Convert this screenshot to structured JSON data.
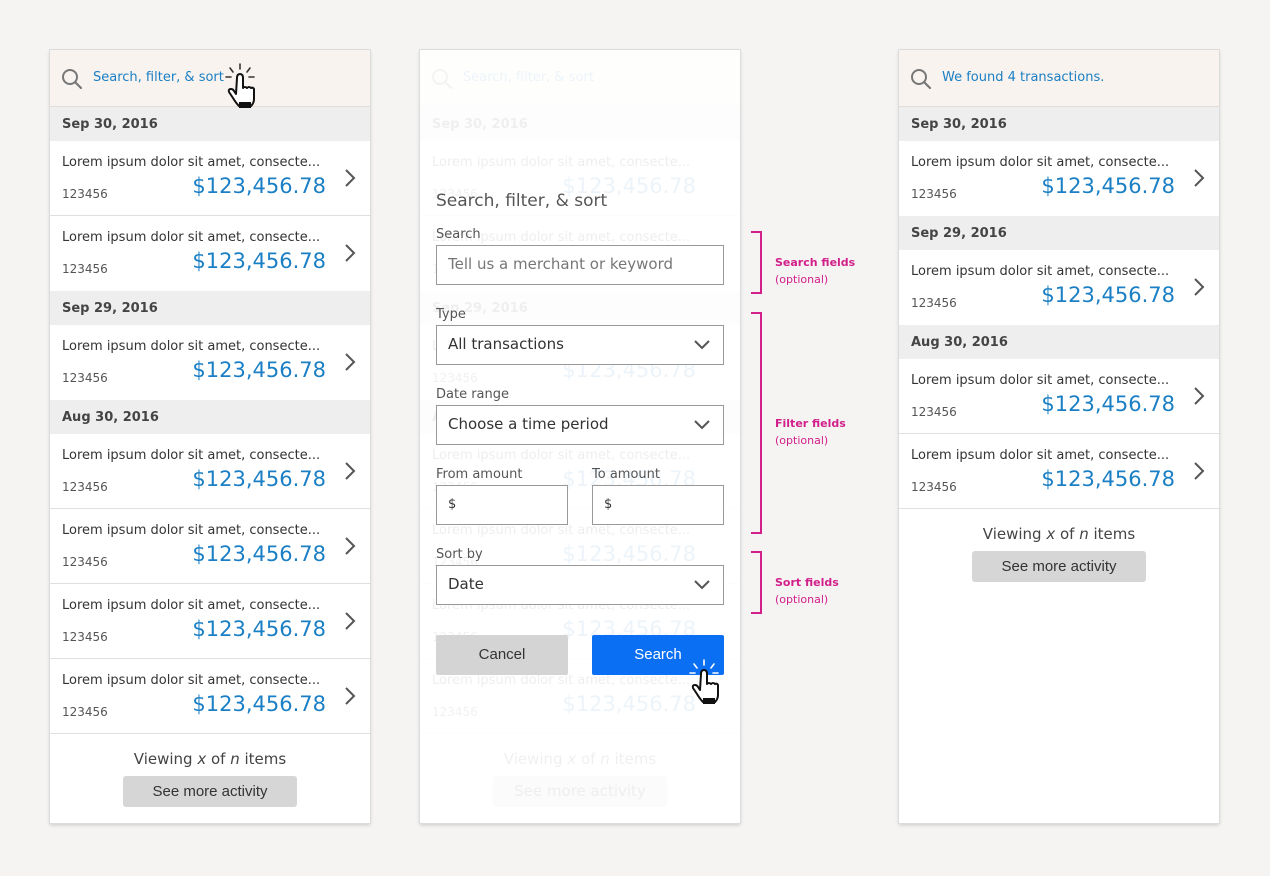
{
  "colors": {
    "link": "#1a7fc4",
    "accent": "#0a6ff2",
    "annotation": "#d21f8a"
  },
  "panel1": {
    "search_placeholder": "Search, filter, & sort",
    "groups": [
      {
        "date": "Sep 30, 2016",
        "rows": [
          {
            "desc": "Lorem ipsum dolor sit amet, consecte...",
            "id": "123456",
            "amount": "$123,456.78"
          },
          {
            "desc": "Lorem ipsum dolor sit amet, consecte...",
            "id": "123456",
            "amount": "$123,456.78"
          }
        ]
      },
      {
        "date": "Sep 29, 2016",
        "rows": [
          {
            "desc": "Lorem ipsum dolor sit amet, consecte...",
            "id": "123456",
            "amount": "$123,456.78"
          }
        ]
      },
      {
        "date": "Aug 30, 2016",
        "rows": [
          {
            "desc": "Lorem ipsum dolor sit amet, consecte...",
            "id": "123456",
            "amount": "$123,456.78"
          },
          {
            "desc": "Lorem ipsum dolor sit amet, consecte...",
            "id": "123456",
            "amount": "$123,456.78"
          },
          {
            "desc": "Lorem ipsum dolor sit amet, consecte...",
            "id": "123456",
            "amount": "$123,456.78"
          },
          {
            "desc": "Lorem ipsum dolor sit amet, consecte...",
            "id": "123456",
            "amount": "$123,456.78"
          }
        ]
      }
    ],
    "viewing_pre": "Viewing ",
    "viewing_x": "x",
    "viewing_mid": " of ",
    "viewing_n": "n",
    "viewing_post": " items",
    "more_label": "See more activity"
  },
  "form": {
    "title": "Search, filter, & sort",
    "search_label": "Search",
    "search_placeholder": "Tell us a merchant or keyword",
    "type_label": "Type",
    "type_value": "All transactions",
    "date_label": "Date range",
    "date_value": "Choose a time period",
    "from_label": "From amount",
    "to_label": "To amount",
    "currency": "$",
    "sort_label": "Sort by",
    "sort_value": "Date",
    "cancel_label": "Cancel",
    "search_button": "Search"
  },
  "annotations": {
    "search": {
      "title": "Search fields",
      "note": "(optional)"
    },
    "filter": {
      "title": "Filter fields",
      "note": "(optional)"
    },
    "sort": {
      "title": "Sort fields",
      "note": "(optional)"
    }
  },
  "panel3": {
    "result_text": "We found 4 transactions.",
    "groups": [
      {
        "date": "Sep 30, 2016",
        "rows": [
          {
            "desc": "Lorem ipsum dolor sit amet, consecte...",
            "id": "123456",
            "amount": "$123,456.78"
          }
        ]
      },
      {
        "date": "Sep 29, 2016",
        "rows": [
          {
            "desc": "Lorem ipsum dolor sit amet, consecte...",
            "id": "123456",
            "amount": "$123,456.78"
          }
        ]
      },
      {
        "date": "Aug 30, 2016",
        "rows": [
          {
            "desc": "Lorem ipsum dolor sit amet, consecte...",
            "id": "123456",
            "amount": "$123,456.78"
          },
          {
            "desc": "Lorem ipsum dolor sit amet, consecte...",
            "id": "123456",
            "amount": "$123,456.78"
          }
        ]
      }
    ],
    "more_label": "See more activity"
  }
}
